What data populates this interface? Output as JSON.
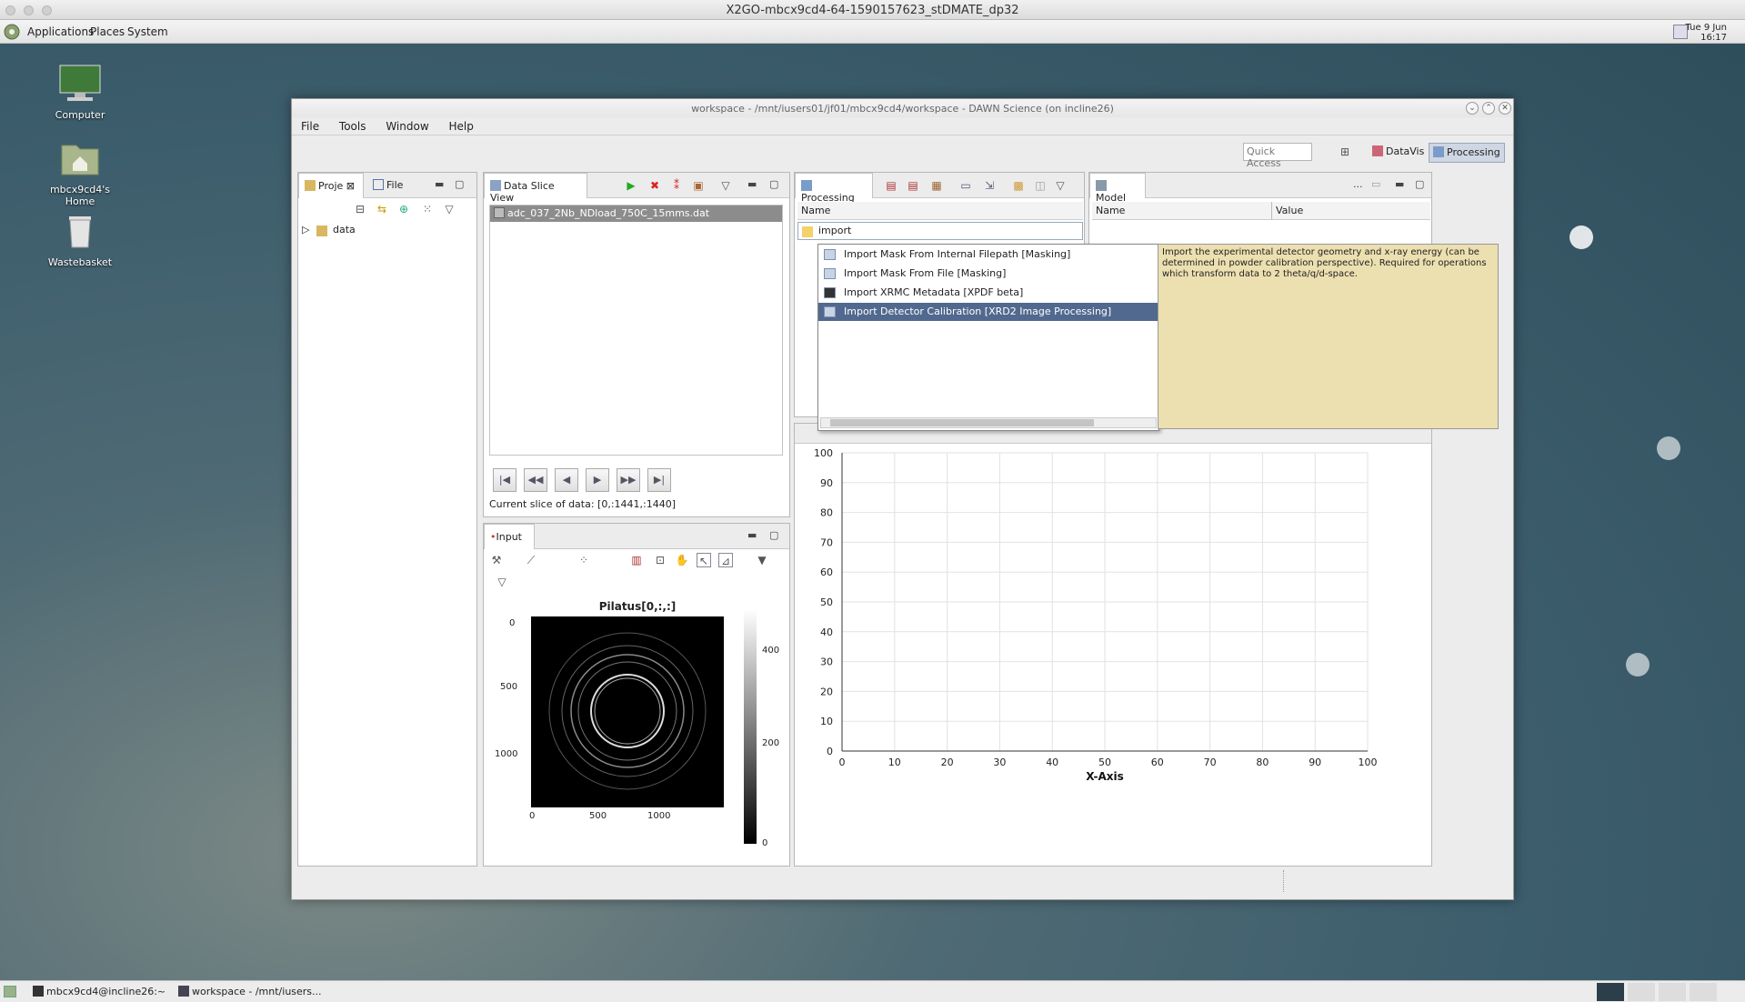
{
  "x2go": {
    "title": "X2GO-mbcx9cd4-64-1590157623_stDMATE_dp32"
  },
  "panel": {
    "menus": [
      "Applications",
      "Places",
      "System"
    ],
    "clock_day": "Tue  9 Jun",
    "clock_time": "16:17"
  },
  "desktop": {
    "icons": [
      {
        "label": "Computer",
        "icon": "computer-icon"
      },
      {
        "label": "mbcx9cd4's Home",
        "icon": "home-folder-icon"
      },
      {
        "label": "Wastebasket",
        "icon": "trash-icon"
      }
    ]
  },
  "window": {
    "title": "workspace - /mnt/iusers01/jf01/mbcx9cd4/workspace - DAWN Science  (on incline26)",
    "menu": [
      "File",
      "Tools",
      "Window",
      "Help"
    ],
    "quick_access": "Quick Access",
    "perspectives": [
      "DataVis",
      "Processing"
    ]
  },
  "project": {
    "tabs": [
      "Proje",
      "File"
    ],
    "tree": [
      {
        "label": "data"
      }
    ]
  },
  "dataslice": {
    "tab": "Data Slice View",
    "file": "adc_037_2Nb_NDload_750C_15mms.dat",
    "slice_label": "Current slice of data: [0,:1441,:1440]"
  },
  "input": {
    "tab": "Input",
    "image_title": "Pilatus[0,:,:]",
    "y_ticks": [
      "0",
      "500",
      "1000"
    ],
    "x_ticks": [
      "0",
      "500",
      "1000"
    ],
    "colorbar_ticks": [
      "400",
      "200",
      "0"
    ]
  },
  "processing": {
    "tab": "Processing",
    "col_name": "Name",
    "search_value": "import",
    "popup_items": [
      {
        "label": "Import Mask From Internal Filepath   [Masking]",
        "selected": false
      },
      {
        "label": "Import Mask From File   [Masking]",
        "selected": false
      },
      {
        "label": "Import XRMC Metadata   [XPDF beta]",
        "selected": false
      },
      {
        "label": "Import Detector Calibration   [XRD2 Image Processing]",
        "selected": true
      }
    ],
    "tooltip": "Import the experimental detector geometry and x-ray energy (can be determined in powder calibration perspective). Required for operations which transform data to 2 theta/q/d-space."
  },
  "model": {
    "tab": "Model",
    "col_name": "Name",
    "col_value": "Value",
    "ellipsis": "..."
  },
  "taskbar": {
    "items": [
      "mbcx9cd4@incline26:~",
      "workspace - /mnt/iusers..."
    ]
  },
  "chart_data": {
    "type": "line",
    "title": "",
    "xlabel": "X-Axis",
    "ylabel": "",
    "xlim": [
      0,
      100
    ],
    "ylim": [
      0,
      100
    ],
    "x_ticks": [
      0,
      10,
      20,
      30,
      40,
      50,
      60,
      70,
      80,
      90,
      100
    ],
    "y_ticks": [
      0,
      10,
      20,
      30,
      40,
      50,
      60,
      70,
      80,
      90,
      100
    ],
    "grid": true,
    "series": []
  }
}
